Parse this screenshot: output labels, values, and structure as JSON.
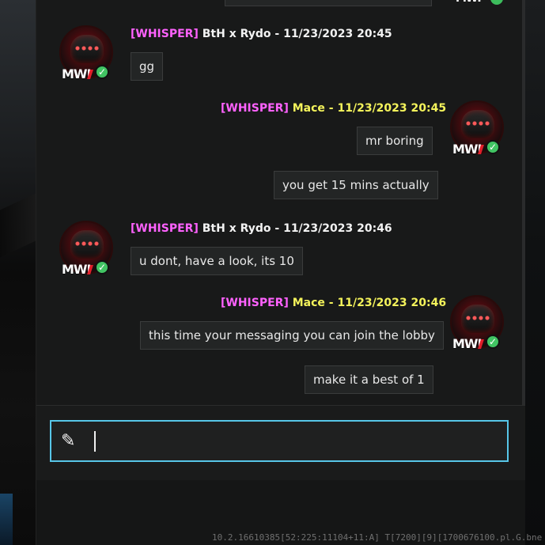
{
  "theme": {
    "accent_border": "#57c6e8",
    "whisper_tag_color": "#ff62ff",
    "self_name_color": "#f4f35b",
    "other_name_color": "#f2f2f2",
    "check_color": "#41c463"
  },
  "chat": {
    "messages": [
      {
        "tag": "[WHISPER]",
        "sender": "BtH x Rydo",
        "timestamp": "11/23/2023 20:45",
        "text": "gg",
        "avatar": {
          "logo_text": "MWI",
          "verified_icon": "check-icon"
        }
      },
      {
        "tag": "[WHISPER]",
        "sender": "Mace",
        "timestamp": "11/23/2023 20:45",
        "bubbles": [
          "mr boring",
          "you get 15 mins actually"
        ],
        "avatar": {
          "logo_text": "MWI",
          "verified_icon": "check-icon"
        }
      },
      {
        "tag": "[WHISPER]",
        "sender": "BtH x Rydo",
        "timestamp": "11/23/2023 20:46",
        "text": "u dont, have a look, its 10",
        "avatar": {
          "logo_text": "MWI",
          "verified_icon": "check-icon"
        }
      },
      {
        "tag": "[WHISPER]",
        "sender": "Mace",
        "timestamp": "11/23/2023 20:46",
        "bubbles": [
          "this time your messaging you can join the lobby",
          "make it a best of 1"
        ],
        "avatar": {
          "logo_text": "MWI",
          "verified_icon": "check-icon"
        }
      }
    ],
    "separator": "-"
  },
  "composer": {
    "input_value": "",
    "input_placeholder": ""
  },
  "footer": {
    "debug_text": "10.2.16610385[52:225:11104+11:A] T[7200][9][1700676100.pl.G.bne"
  }
}
